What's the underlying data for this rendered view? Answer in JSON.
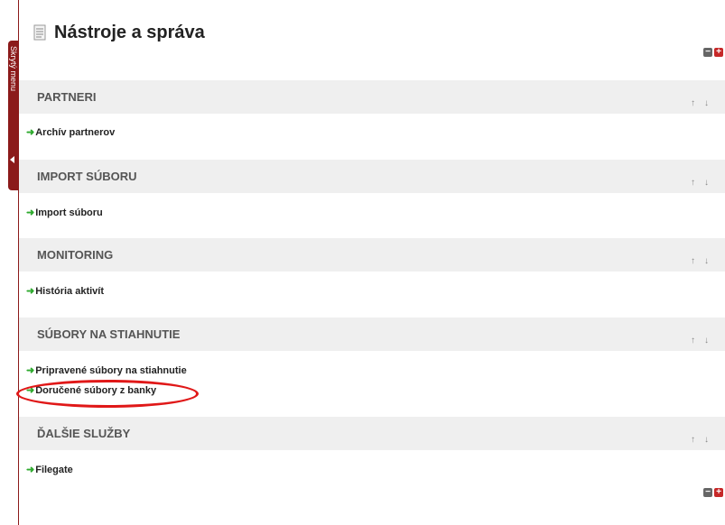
{
  "sidebar_toggle": {
    "label": "Skrytý menu"
  },
  "page": {
    "title": "Nástroje a správa"
  },
  "controls": {
    "collapse": "−",
    "expand": "+"
  },
  "sections": [
    {
      "title": "PARTNERI",
      "links": [
        "Archív partnerov"
      ]
    },
    {
      "title": "IMPORT SÚBORU",
      "links": [
        "Import súboru"
      ]
    },
    {
      "title": "MONITORING",
      "links": [
        "História aktivít"
      ]
    },
    {
      "title": "SÚBORY NA STIAHNUTIE",
      "links": [
        "Pripravené súbory na stiahnutie",
        "Doručené súbory z banky"
      ]
    },
    {
      "title": "ĎALŠIE SLUŽBY",
      "links": [
        "Filegate"
      ]
    }
  ],
  "arrows": {
    "up": "↑",
    "down": "↓",
    "link": "➜"
  },
  "colors": {
    "accent": "#8b1a1a",
    "link_arrow": "#2eaa2e",
    "highlight": "#e01818",
    "section_bg": "#efefef"
  }
}
